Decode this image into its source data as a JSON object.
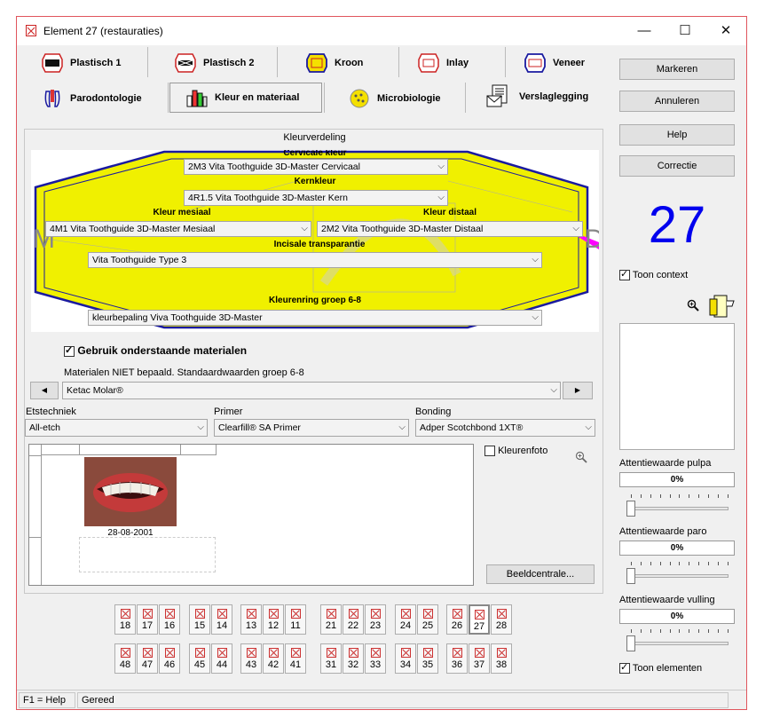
{
  "window": {
    "title": "Element 27 (restauraties)",
    "minimize": "—",
    "maximize": "☐",
    "close": "✕"
  },
  "tabs": [
    {
      "label": "Plastisch 1",
      "icon": "plastisch-icon"
    },
    {
      "label": "Plastisch 2",
      "icon": "plastisch-icon"
    },
    {
      "label": "Kroon",
      "icon": "kroon-icon"
    },
    {
      "label": "Inlay",
      "icon": "inlay-icon"
    },
    {
      "label": "Veneer",
      "icon": "veneer-icon"
    },
    {
      "label": "Parodontologie",
      "icon": "parodontologie-icon"
    },
    {
      "label": "Kleur en materiaal",
      "icon": "kleur-materiaal-icon"
    },
    {
      "label": "Microbiologie",
      "icon": "microbiologie-icon"
    },
    {
      "label": "Verslaglegging",
      "icon": "verslaglegging-icon"
    }
  ],
  "side_buttons": {
    "markeren": "Markeren",
    "annuleren": "Annuleren",
    "help": "Help",
    "correctie": "Correctie"
  },
  "element_number": "27",
  "toon_context": "Toon context",
  "toon_elementen": "Toon elementen",
  "colors": {
    "accent": "#0000ee",
    "yellow": "#f0f000",
    "navy": "#1a1aa0",
    "magenta": "#ff00ff"
  },
  "kleur": {
    "group_title": "Kleurverdeling",
    "cervicale_label": "Cervicale kleur",
    "cervicale_value": "2M3 Vita Toothguide 3D-Master Cervicaal",
    "kern_label": "Kernkleur",
    "kern_value": "4R1.5 Vita Toothguide 3D-Master Kern",
    "mesiaal_label": "Kleur mesiaal",
    "mesiaal_value": "4M1 Vita Toothguide 3D-Master Mesiaal",
    "distaal_label": "Kleur distaal",
    "distaal_value": "2M2 Vita Toothguide 3D-Master Distaal",
    "incisale_label": "Incisale transparantie",
    "incisale_value": "Vita Toothguide Type 3",
    "ring_label": "Kleurenring groep 6-8",
    "ring_value": "kleurbepaling Viva Toothguide 3D-Master",
    "letter_m": "M",
    "letter_d": "D"
  },
  "materialen": {
    "use_label": "Gebruik onderstaande materialen",
    "note": "Materialen NIET bepaald. Standaardwaarden groep 6-8",
    "value": "Ketac Molar®",
    "prev": "◀",
    "next": "▶"
  },
  "etstechniek": {
    "label": "Etstechniek",
    "value": "All-etch"
  },
  "primer": {
    "label": "Primer",
    "value": "Clearfill® SA Primer"
  },
  "bonding": {
    "label": "Bonding",
    "value": "Adper Scotchbond 1XT®"
  },
  "photo": {
    "date": "28-08-2001",
    "kleurenfoto": "Kleurenfoto",
    "beeldcentrale": "Beeldcentrale..."
  },
  "attentie": {
    "pulpa_label": "Attentiewaarde pulpa",
    "pulpa_value": "0%",
    "paro_label": "Attentiewaarde paro",
    "paro_value": "0%",
    "vulling_label": "Attentiewaarde vulling",
    "vulling_value": "0%"
  },
  "teeth_top": [
    "18",
    "17",
    "16",
    "15",
    "14",
    "13",
    "12",
    "11",
    "21",
    "22",
    "23",
    "24",
    "25",
    "26",
    "27",
    "28"
  ],
  "teeth_bottom": [
    "48",
    "47",
    "46",
    "45",
    "44",
    "43",
    "42",
    "41",
    "31",
    "32",
    "33",
    "34",
    "35",
    "36",
    "37",
    "38"
  ],
  "status": {
    "help": "F1 = Help",
    "text": "Gereed"
  }
}
